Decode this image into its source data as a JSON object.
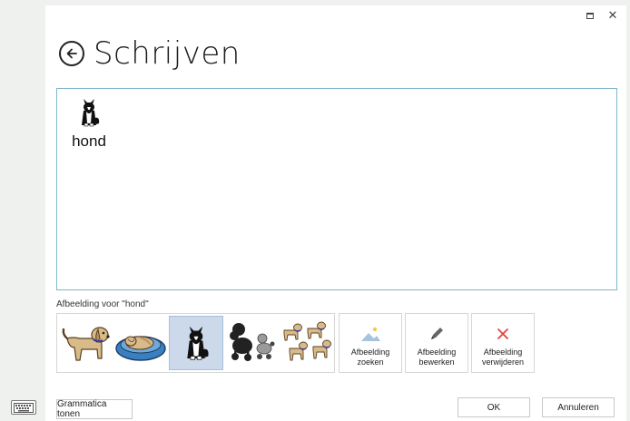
{
  "window": {
    "maximize_glyph": "maximize-icon",
    "close_label": "✕"
  },
  "header": {
    "title": "Schrijven",
    "back_icon": "back-arrow-circle-icon"
  },
  "editor": {
    "word": "hond",
    "word_icon": "dog-border-collie-icon"
  },
  "symbol_picker": {
    "caption": "Afbeelding voor \"hond\"",
    "symbols": [
      {
        "icon": "dog-tan-icon",
        "selected": false
      },
      {
        "icon": "dog-in-basket-icon",
        "selected": false
      },
      {
        "icon": "dog-border-collie-icon",
        "selected": true
      },
      {
        "icon": "dog-poodles-icon",
        "selected": false
      },
      {
        "icon": "dogs-group-icon",
        "selected": false
      }
    ]
  },
  "actions": {
    "search_line1": "Afbeelding",
    "search_line2": "zoeken",
    "edit_line1": "Afbeelding",
    "edit_line2": "bewerken",
    "delete_line1": "Afbeelding",
    "delete_line2": "verwijderen"
  },
  "footer": {
    "grammar_label": "Grammatica tonen",
    "ok_label": "OK",
    "cancel_label": "Annuleren"
  },
  "colors": {
    "accent_border": "#7fb5cc",
    "selected_bg": "#cbd9ea",
    "delete_red": "#e0453a",
    "search_blue": "#a9c3de"
  }
}
